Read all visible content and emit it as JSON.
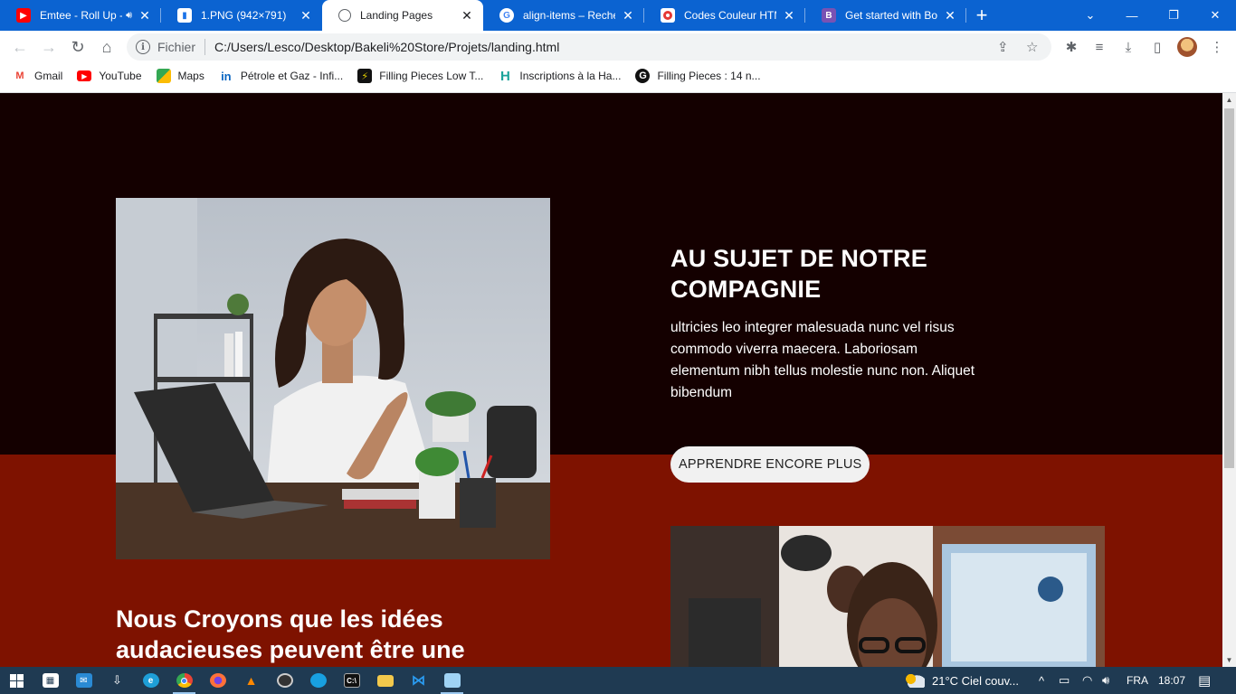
{
  "browser": {
    "tabs": [
      {
        "title": "Emtee - Roll Up -",
        "favicon": "youtube-icon",
        "favicon_color": "#ff0000",
        "audio": true
      },
      {
        "title": "1.PNG (942×791)",
        "favicon": "image-icon",
        "favicon_color": "#1a73e8"
      },
      {
        "title": "Landing Pages",
        "favicon": "globe-icon",
        "favicon_color": "#5f6368",
        "active": true
      },
      {
        "title": "align-items – Recherch",
        "favicon": "google-icon",
        "favicon_color": "#ffffff"
      },
      {
        "title": "Codes Couleur HTML",
        "favicon": "red-target-icon",
        "favicon_color": "#e53935"
      },
      {
        "title": "Get started with Boot",
        "favicon": "bootstrap-icon",
        "favicon_color": "#7952b3"
      }
    ],
    "address": {
      "scheme_label": "Fichier",
      "url": "C:/Users/Lesco/Desktop/Bakeli%20Store/Projets/landing.html"
    },
    "bookmarks": [
      {
        "label": "Gmail",
        "icon": "gmail-icon",
        "color": "#ea4335"
      },
      {
        "label": "YouTube",
        "icon": "youtube-icon",
        "color": "#ff0000"
      },
      {
        "label": "Maps",
        "icon": "maps-icon",
        "color": "#34a853"
      },
      {
        "label": "Pétrole et Gaz - Infi...",
        "icon": "linkedin-icon",
        "color": "#0a66c2"
      },
      {
        "label": "Filling Pieces Low T...",
        "icon": "filling-pieces-icon",
        "color": "#111111"
      },
      {
        "label": "Inscriptions à la Ha...",
        "icon": "h-icon",
        "color": "#1aa39a"
      },
      {
        "label": "Filling Pieces : 14 n...",
        "icon": "g-icon",
        "color": "#111111"
      }
    ]
  },
  "page": {
    "about_title": "AU SUJET DE NOTRE COMPAGNIE",
    "about_text": "ultricies leo integrer malesuada nunc vel risus commodo viverra maecera. Laboriosam elementum nibh tellus molestie nunc non. Aliquet bibendum",
    "learn_more_label": "APPRENDRE ENCORE PLUS",
    "believe_heading": "Nous Croyons que les idées audacieuses peuvent être une",
    "colors": {
      "dark_band": "#140000",
      "red_band": "#7e1200"
    }
  },
  "taskbar": {
    "weather": "21°C  Ciel couv...",
    "language": "FRA",
    "time": "18:07"
  }
}
